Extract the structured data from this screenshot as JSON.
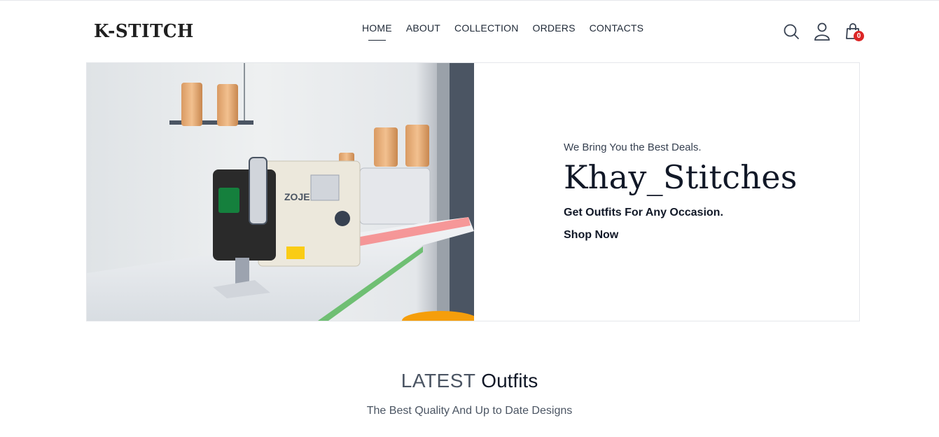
{
  "brand": {
    "logo_text": "K-STITCH"
  },
  "nav": {
    "items": [
      {
        "label": "HOME",
        "active": true
      },
      {
        "label": "ABOUT"
      },
      {
        "label": "COLLECTION"
      },
      {
        "label": "ORDERS"
      },
      {
        "label": "CONTACTS"
      }
    ]
  },
  "header_icons": {
    "search": "search-icon",
    "account": "user-icon",
    "cart": "shopping-bag-icon",
    "cart_count": "0",
    "badge_color": "#dc2626"
  },
  "hero": {
    "tagline": "We Bring You the Best Deals.",
    "title": "Khay_Stitches",
    "subtitle": "Get Outfits For Any Occasion.",
    "cta": "Shop Now",
    "image": "sewing-machine-photo"
  },
  "latest": {
    "title_light": "LATEST",
    "title_strong": "Outfits",
    "subtitle": "The Best Quality And Up to Date Designs"
  }
}
